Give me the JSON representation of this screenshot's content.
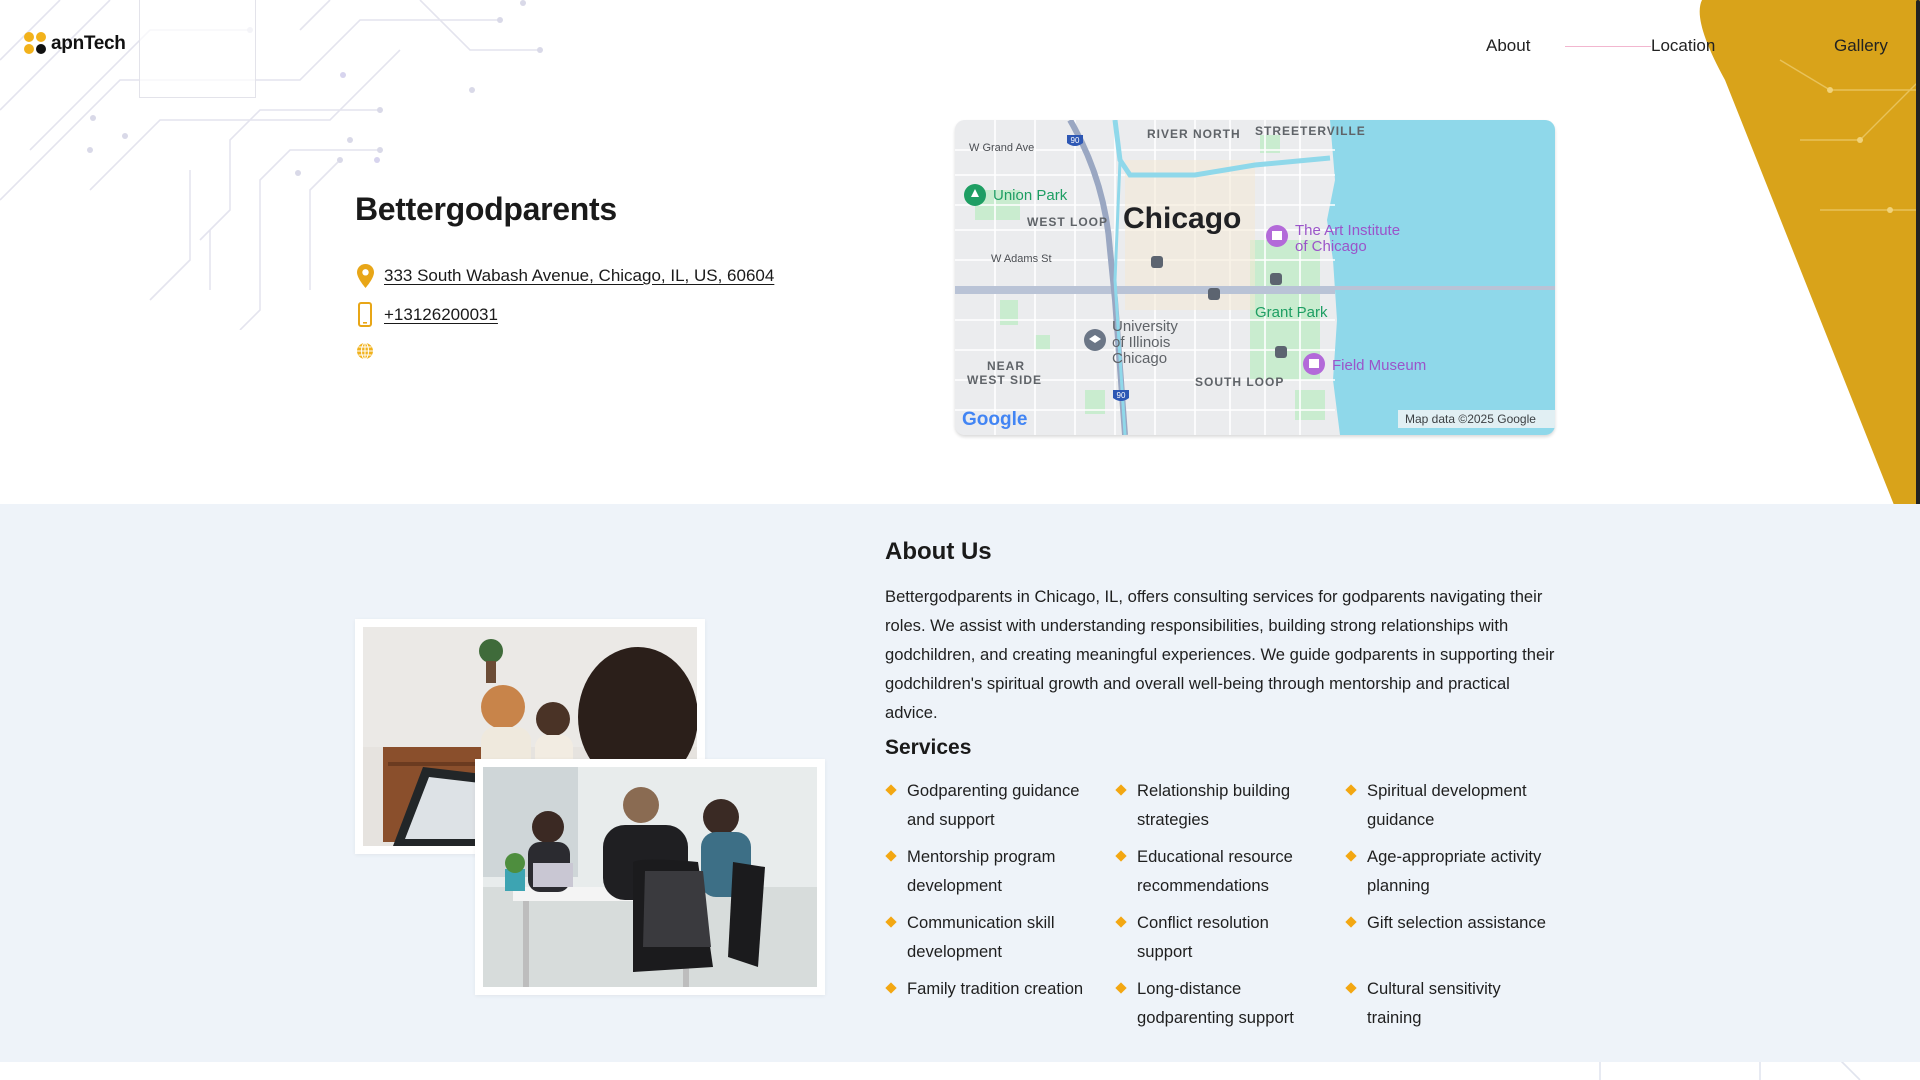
{
  "header": {
    "logo_text": "apnTech",
    "nav": [
      {
        "label": "About"
      },
      {
        "label": "Location"
      },
      {
        "label": "Gallery"
      }
    ]
  },
  "business": {
    "name": "Bettergodparents",
    "address": "333 South Wabash Avenue, Chicago, IL, US, 60604",
    "phone": "+13126200031"
  },
  "map": {
    "labels": {
      "river_north": "RIVER NORTH",
      "streeterville": "STREETERVILLE",
      "w_grand": "W Grand Ave",
      "union_park": "Union Park",
      "west_loop": "WEST LOOP",
      "chicago": "Chicago",
      "art_institute_1": "The Art Institute",
      "art_institute_2": "of Chicago",
      "w_adams": "W Adams St",
      "grant_park": "Grant Park",
      "uic_1": "University",
      "uic_2": "of Illinois",
      "uic_3": "Chicago",
      "near_1": "NEAR",
      "near_2": "WEST SIDE",
      "south_loop": "SOUTH LOOP",
      "field_museum": "Field Museum",
      "hw_90": "90",
      "google": "Google",
      "attribution": "Map data ©2025 Google"
    }
  },
  "about": {
    "title": "About Us",
    "text": "Bettergodparents in Chicago, IL, offers consulting services for godparents navigating their roles. We assist with understanding responsibilities, building strong relationships with godchildren, and creating meaningful experiences. We guide godparents in supporting their godchildren's spiritual growth and overall well-being through mentorship and practical advice.",
    "services_title": "Services",
    "services": [
      "Godparenting guidance and support",
      "Relationship building strategies",
      "Spiritual development guidance",
      "Mentorship program development",
      "Educational resource recommendations",
      "Age-appropriate activity planning",
      "Communication skill development",
      "Conflict resolution support",
      "Gift selection assistance",
      "Family tradition creation",
      "Long-distance godparenting support",
      "Cultural sensitivity training"
    ]
  },
  "colors": {
    "accent": "#f2b21b",
    "yellow_band": "#d9a31a",
    "section_bg": "#eef3f9",
    "water": "#8fd8ea",
    "park": "#c9eccf"
  },
  "icons": {
    "address": "map-pin-icon",
    "phone": "mobile-phone-icon",
    "website": "globe-icon",
    "bullet": "diamond-bullet-icon"
  }
}
